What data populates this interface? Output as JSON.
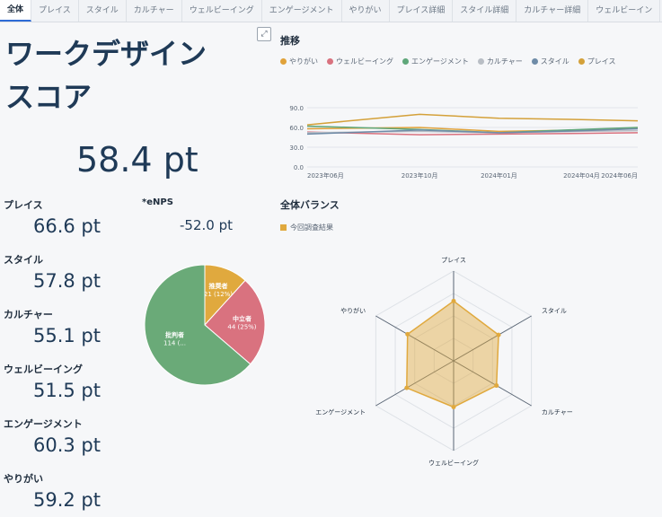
{
  "tabs": [
    "全体",
    "プレイス",
    "スタイル",
    "カルチャー",
    "ウェルビーイング",
    "エンゲージメント",
    "やりがい",
    "プレイス詳細",
    "スタイル詳細",
    "カルチャー詳細",
    "ウェルビーイン"
  ],
  "title": "ワークデザインスコア",
  "overall": "58.4 pt",
  "metrics": [
    {
      "label": "プレイス",
      "value": "66.6 pt"
    },
    {
      "label": "スタイル",
      "value": "57.8 pt"
    },
    {
      "label": "カルチャー",
      "value": "55.1 pt"
    },
    {
      "label": "ウェルビーイング",
      "value": "51.5 pt"
    },
    {
      "label": "エンゲージメント",
      "value": "60.3 pt"
    },
    {
      "label": "やりがい",
      "value": "59.2 pt"
    }
  ],
  "enps": {
    "label": "*eNPS",
    "value": "-52.0 pt"
  },
  "colors": {
    "yarigai": "#e0a23a",
    "wellbeing": "#d9727f",
    "engagement": "#5fa77a",
    "culture": "#b9bec5",
    "style": "#6f8ca8",
    "place": "#d4a13a",
    "pie_promoter": "#e0a93e",
    "pie_neutral": "#d9727f",
    "pie_critic": "#6aaa78",
    "radar": "#e0a93e"
  },
  "chart_data": [
    {
      "type": "line",
      "title": "推移",
      "x": [
        "2023年06月",
        "2023年10月",
        "2024年01月",
        "2024年04月",
        "2024年06月"
      ],
      "ylim": [
        0,
        90
      ],
      "yticks": [
        "0.0",
        "30.0",
        "60.0",
        "90.0"
      ],
      "series": [
        {
          "name": "やりがい",
          "values": [
            58,
            60,
            54,
            56,
            59
          ]
        },
        {
          "name": "ウェルビーイング",
          "values": [
            53,
            49,
            50,
            51,
            52
          ]
        },
        {
          "name": "エンゲージメント",
          "values": [
            62,
            57,
            52,
            57,
            60
          ]
        },
        {
          "name": "カルチャー",
          "values": [
            52,
            54,
            52,
            54,
            55
          ]
        },
        {
          "name": "スタイル",
          "values": [
            50,
            56,
            52,
            55,
            58
          ]
        },
        {
          "name": "プレイス",
          "values": [
            64,
            80,
            74,
            72,
            70
          ]
        }
      ]
    },
    {
      "type": "pie",
      "slices": [
        {
          "name": "推奨者",
          "label": "推奨者",
          "detail": "21 (12%)",
          "value": 21
        },
        {
          "name": "中立者",
          "label": "中立者",
          "detail": "44 (25%)",
          "value": 44
        },
        {
          "name": "批判者",
          "label": "批判者",
          "detail": "114 (...",
          "value": 114
        }
      ]
    },
    {
      "type": "radar",
      "title": "全体バランス",
      "legend": "今回調査結果",
      "axes": [
        "プレイス",
        "スタイル",
        "カルチャー",
        "ウェルビーイング",
        "エンゲージメント",
        "やりがい"
      ],
      "values": [
        66.6,
        57.8,
        55.1,
        51.5,
        60.3,
        59.2
      ],
      "max": 100
    }
  ]
}
